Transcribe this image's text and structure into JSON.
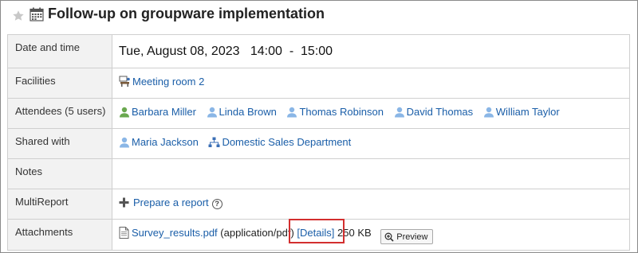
{
  "header": {
    "title": "Follow-up on groupware implementation",
    "star_icon": "star-icon",
    "calendar_icon": "calendar-icon"
  },
  "rows": {
    "date": {
      "label": "Date and time",
      "day": "Tue, August 08, 2023",
      "start": "14:00",
      "separator": "-",
      "end": "15:00"
    },
    "facilities": {
      "label": "Facilities",
      "items": [
        {
          "name": "Meeting room 2",
          "icon": "facility-icon"
        }
      ]
    },
    "attendees": {
      "label": "Attendees (5 users)",
      "users": [
        {
          "name": "Barbara Miller",
          "icon": "user-icon-green"
        },
        {
          "name": "Linda Brown",
          "icon": "user-icon"
        },
        {
          "name": "Thomas Robinson",
          "icon": "user-icon"
        },
        {
          "name": "David Thomas",
          "icon": "user-icon"
        },
        {
          "name": "William Taylor",
          "icon": "user-icon"
        }
      ]
    },
    "shared": {
      "label": "Shared with",
      "items": [
        {
          "name": "Maria Jackson",
          "icon": "user-icon"
        },
        {
          "name": "Domestic Sales Department",
          "icon": "org-icon"
        }
      ]
    },
    "notes": {
      "label": "Notes",
      "value": ""
    },
    "multireport": {
      "label": "MultiReport",
      "action": "Prepare a report",
      "help": "?"
    },
    "attachments": {
      "label": "Attachments",
      "file_name": "Survey_results.pdf",
      "mime": "(application/pdf)",
      "details_link": "[Details]",
      "size": "250 KB",
      "preview_label": "Preview"
    }
  },
  "colors": {
    "link": "#1a5ea8",
    "label_bg": "#f2f2f2",
    "highlight_box": "#d32f2f",
    "user_icon": "#5b9bd5",
    "user_icon_active": "#6aa84f"
  }
}
